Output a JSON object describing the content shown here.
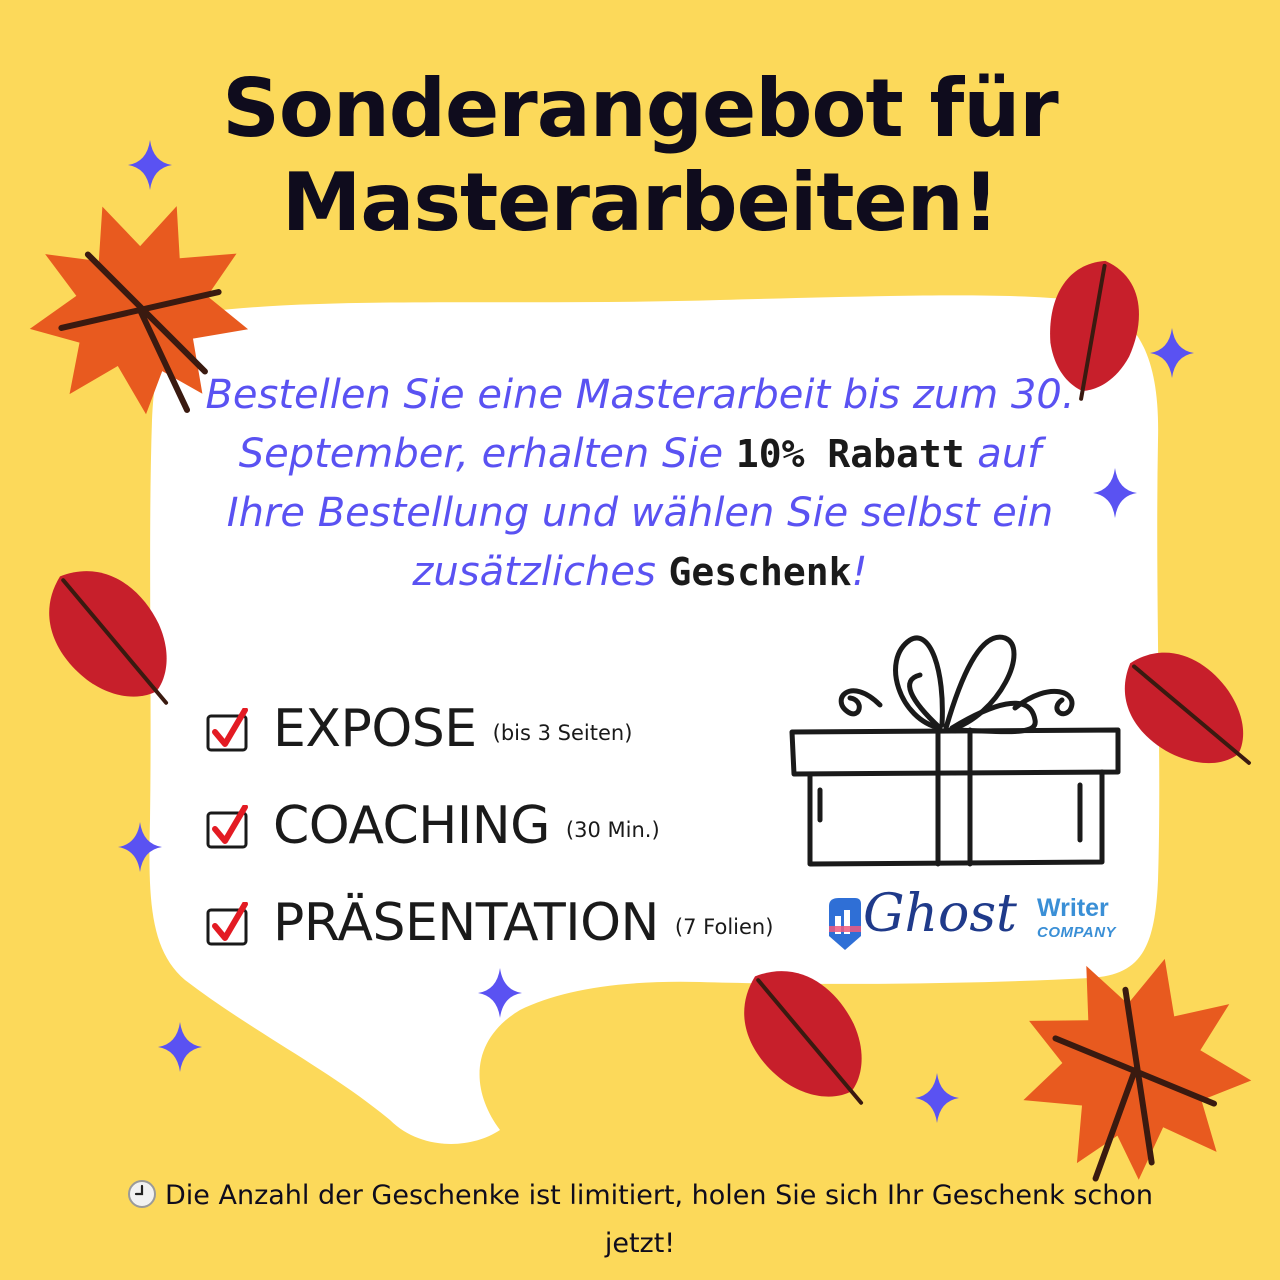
{
  "title": {
    "line1": "Sonderangebot für",
    "line2": "Masterarbeiten!"
  },
  "promo": {
    "part1": "Bestellen Sie eine Masterarbeit bis zum 30. September, erhalten Sie ",
    "highlight1": "10% Rabatt",
    "part2": " auf Ihre Bestellung und wählen Sie selbst ein zusätzliches ",
    "highlight2": "Geschenk",
    "part3": "!"
  },
  "items": [
    {
      "label": "EXPOSE",
      "note": "(bis 3 Seiten)",
      "icon": "checkmark-icon"
    },
    {
      "label": "COACHING",
      "note": "(30 Min.)",
      "icon": "checkmark-icon"
    },
    {
      "label": "PRÄSENTATION",
      "note": "(7 Folien)",
      "icon": "checkmark-icon"
    }
  ],
  "logo": {
    "ghost": "Ghost",
    "writer": "Writer",
    "company": "COMPANY"
  },
  "footer": {
    "icon": "clock-icon",
    "text": "Die Anzahl der Geschenke ist limitiert, holen Sie sich Ihr Geschenk schon jetzt!"
  },
  "colors": {
    "background": "#fcd95a",
    "card": "#ffffff",
    "title": "#0f0c1d",
    "accent": "#5a52f2",
    "leaf_orange": "#e85a1f",
    "leaf_red": "#c71f2b",
    "check_red": "#e31b23"
  }
}
